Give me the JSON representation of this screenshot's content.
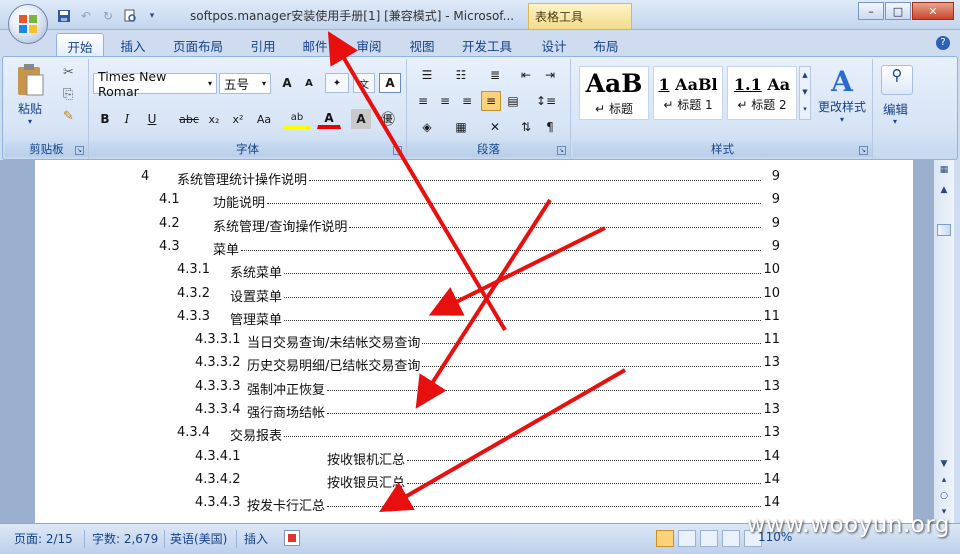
{
  "window": {
    "title": "softpos.manager安装使用手册[1] [兼容模式] - Microsof...",
    "context_tab": "表格工具",
    "ctrl": {
      "min": "–",
      "max": "□",
      "close": "✕"
    }
  },
  "tabs": [
    {
      "label": "开始"
    },
    {
      "label": "插入"
    },
    {
      "label": "页面布局"
    },
    {
      "label": "引用"
    },
    {
      "label": "邮件"
    },
    {
      "label": "审阅"
    },
    {
      "label": "视图"
    },
    {
      "label": "开发工具"
    },
    {
      "label": "设计"
    },
    {
      "label": "布局"
    }
  ],
  "ribbon": {
    "clipboard": {
      "paste": "粘贴",
      "label": "剪贴板"
    },
    "font": {
      "name": "Times New Romar",
      "size": "五号",
      "label": "字体",
      "bold": "B",
      "italic": "I",
      "underline": "U",
      "strike": "abc",
      "sub": "x₂",
      "sup": "x²",
      "case": "Aa",
      "highlight": "ab",
      "color": "A",
      "grow": "A",
      "shrink": "A",
      "clear": "A"
    },
    "paragraph": {
      "label": "段落"
    },
    "styles": {
      "label": "样式",
      "items": [
        {
          "sample": "AaB",
          "name": "标题"
        },
        {
          "sample": "AaBl",
          "name": "标题 1"
        },
        {
          "sample": "Aa",
          "name": "标题 2"
        }
      ],
      "n1": "1",
      "n2": "1.1",
      "change": "更改样式"
    },
    "editing": {
      "label": "编辑"
    }
  },
  "toc": [
    {
      "num": "4",
      "text": "系统管理统计操作说明",
      "page": "9"
    },
    {
      "num": "4.1",
      "text": "功能说明",
      "page": "9"
    },
    {
      "num": "4.2",
      "text": "系统管理/查询操作说明",
      "page": "9"
    },
    {
      "num": "4.3",
      "text": "菜单",
      "page": "9"
    },
    {
      "num": "4.3.1",
      "text": "系统菜单",
      "page": "10"
    },
    {
      "num": "4.3.2",
      "text": "设置菜单",
      "page": "10"
    },
    {
      "num": "4.3.3",
      "text": "管理菜单",
      "page": "11"
    },
    {
      "num": "4.3.3.1",
      "text": "当日交易查询/未结帐交易查询",
      "page": "11"
    },
    {
      "num": "4.3.3.2",
      "text": "历史交易明细/已结帐交易查询",
      "page": "13"
    },
    {
      "num": "4.3.3.3",
      "text": "强制冲正恢复",
      "page": "13"
    },
    {
      "num": "4.3.3.4",
      "text": "强行商场结帐",
      "page": "13"
    },
    {
      "num": "4.3.4",
      "text": "交易报表",
      "page": "13"
    },
    {
      "num": "4.3.4.1",
      "text": "按收银机汇总",
      "page": "14"
    },
    {
      "num": "4.3.4.2",
      "text": "按收银员汇总",
      "page": "14"
    },
    {
      "num": "4.3.4.3",
      "text": "按发卡行汇总",
      "page": "14"
    }
  ],
  "status": {
    "page": "页面: 2/15",
    "words": "字数: 2,679",
    "lang": "英语(美国)",
    "mode": "插入",
    "zoom": "110%"
  },
  "watermark": "www.wooyun.org",
  "colors": {
    "arrow": "#e8100f"
  }
}
